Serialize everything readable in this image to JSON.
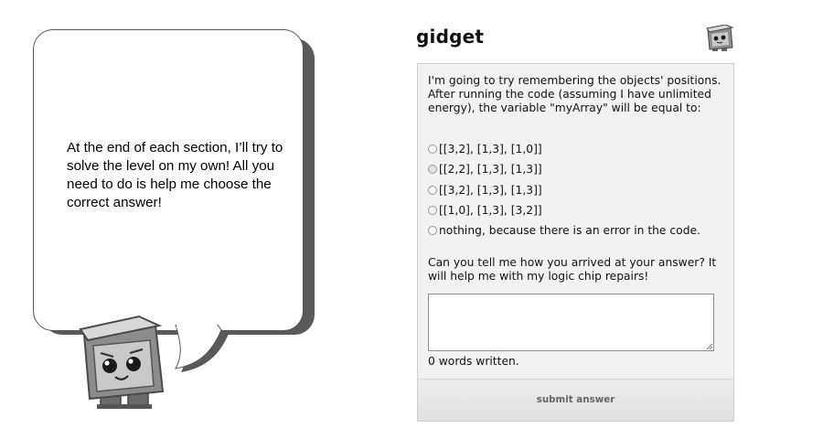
{
  "bubble": {
    "text": "At the end of each section, I’ll try to solve the level on my own! All you need to do is help me choose the correct answer!"
  },
  "header": {
    "title": "gidget"
  },
  "quiz": {
    "question": "I'm going to try remembering the objects' positions. After running the code (assuming I have unlimited energy), the variable \"myArray\" will be equal to:",
    "options": [
      "[[3,2], [1,3], [1,0]]",
      "[[2,2], [1,3], [1,3]]",
      "[[3,2], [1,3], [1,3]]",
      "[[1,0], [1,3], [3,2]]",
      "nothing, because there is an error in the code."
    ],
    "prompt": "Can you tell me how you arrived at your answer? It will help me with my logic chip repairs!",
    "answer_value": "",
    "word_count": "0 words written.",
    "submit_label": "submit answer"
  },
  "colors": {
    "panel_bg": "#f2f2f2",
    "bubble_shadow": "#5a5a5a",
    "robot_gray": "#8c8c8c"
  },
  "icons": {
    "mascot": "gidget-robot-icon",
    "header_mascot": "gidget-face-icon"
  }
}
